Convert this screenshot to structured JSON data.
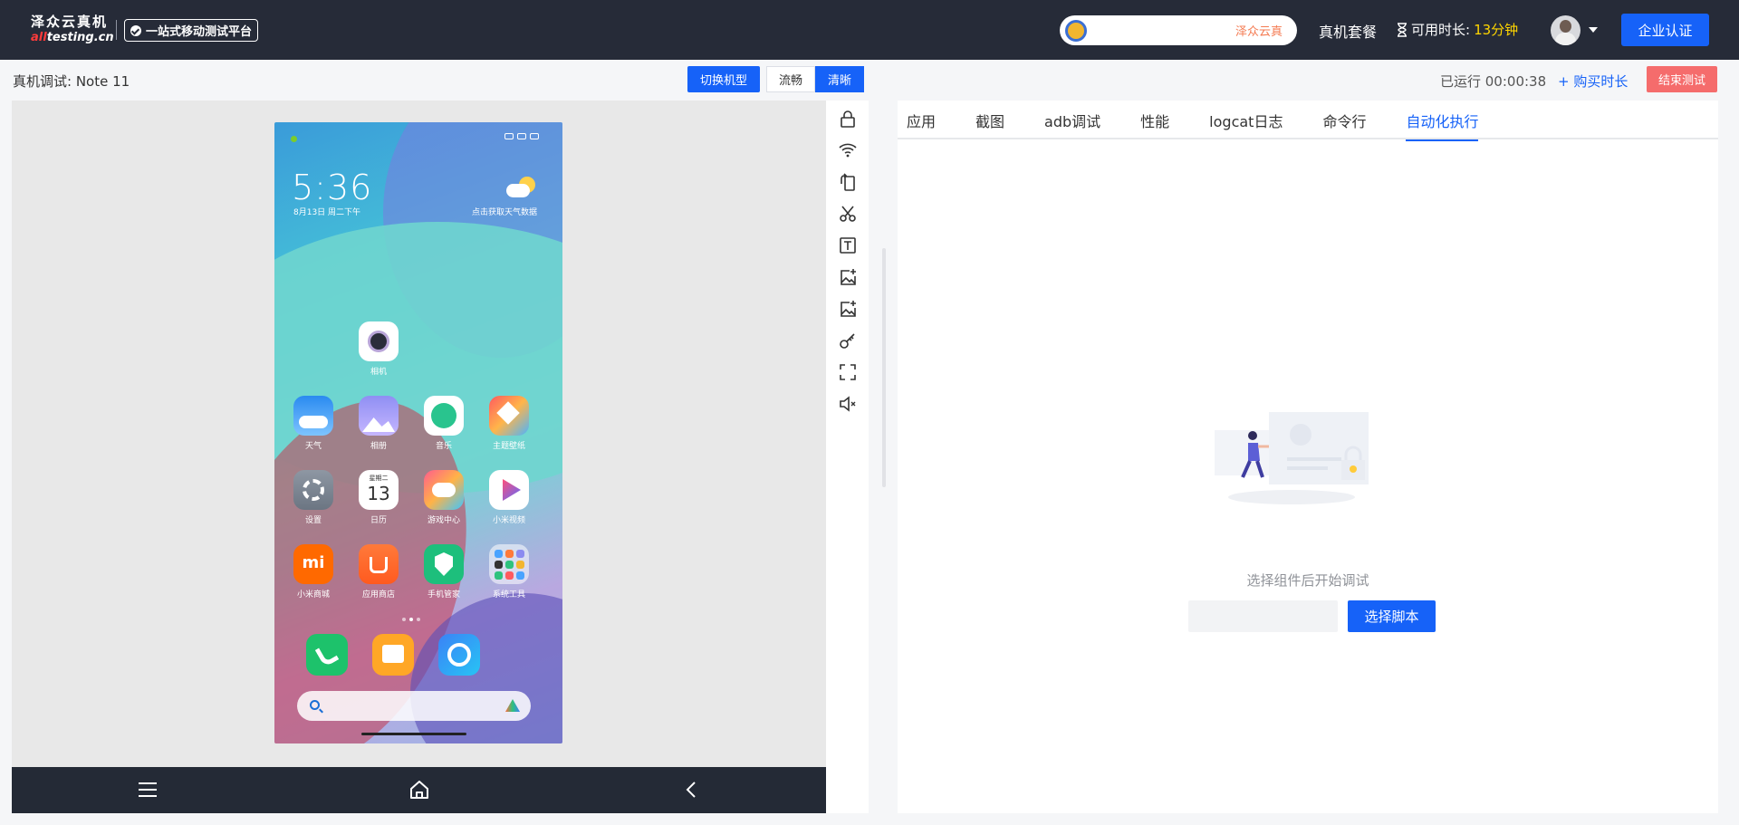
{
  "header": {
    "logo_cn": "泽众云真机",
    "logo_en_prefix": "all",
    "logo_en_suffix": "testing.cn",
    "slogan": "一站式移动测试平台",
    "search_pill_text": "泽众云真",
    "nav_package": "真机套餐",
    "time_label": "可用时长:",
    "time_value": "13分钟",
    "enterprise_button": "企业认证"
  },
  "subheader": {
    "title": "真机调试:  Note 11",
    "switch_button": "切换机型",
    "quality_options": [
      "流畅",
      "清晰"
    ],
    "quality_selected": "清晰",
    "run_time": "已运行 00:00:38",
    "buy_link": "+ 购买时长",
    "end_button": "结束测试"
  },
  "phone": {
    "clock": "5:36",
    "date": "8月13日 周二下午",
    "weather_note": "点击获取天气数据",
    "apps": [
      {
        "name": "相机",
        "icon": "camera-icon"
      },
      {
        "name": "天气",
        "icon": "weather-app-icon"
      },
      {
        "name": "相册",
        "icon": "gallery-icon"
      },
      {
        "name": "音乐",
        "icon": "music-icon"
      },
      {
        "name": "主题壁纸",
        "icon": "themes-icon"
      },
      {
        "name": "设置",
        "icon": "settings-icon"
      },
      {
        "name": "日历",
        "icon": "calendar-icon"
      },
      {
        "name": "游戏中心",
        "icon": "game-center-icon"
      },
      {
        "name": "小米视频",
        "icon": "video-icon"
      },
      {
        "name": "小米商城",
        "icon": "mi-store-icon"
      },
      {
        "name": "应用商店",
        "icon": "app-store-icon"
      },
      {
        "name": "手机管家",
        "icon": "security-icon"
      },
      {
        "name": "系统工具",
        "icon": "tools-folder-icon"
      }
    ],
    "calendar_weekday": "星期二",
    "calendar_day": "13",
    "mi_logo": "mi",
    "dock": [
      {
        "icon": "phone-dialer-icon"
      },
      {
        "icon": "messages-icon"
      },
      {
        "icon": "browser-icon"
      }
    ]
  },
  "device_nav": {
    "menu_icon": "menu-icon",
    "home_icon": "home-icon",
    "back_icon": "back-icon"
  },
  "toolbar": [
    "lock-icon",
    "wifi-icon",
    "rotate-icon",
    "scissors-icon",
    "text-input-icon",
    "image-upload-icon",
    "image-add-icon",
    "key-icon",
    "fullscreen-icon",
    "mute-icon"
  ],
  "tabs": [
    "应用",
    "截图",
    "adb调试",
    "性能",
    "logcat日志",
    "命令行",
    "自动化执行"
  ],
  "active_tab": "自动化执行",
  "automation": {
    "empty_text": "选择组件后开始调试",
    "script_input_value": "",
    "select_script_button": "选择脚本"
  },
  "colors": {
    "topbar": "#262b38",
    "primary": "#1662f8",
    "danger": "#f56c6c",
    "highlight": "#ffd600"
  }
}
